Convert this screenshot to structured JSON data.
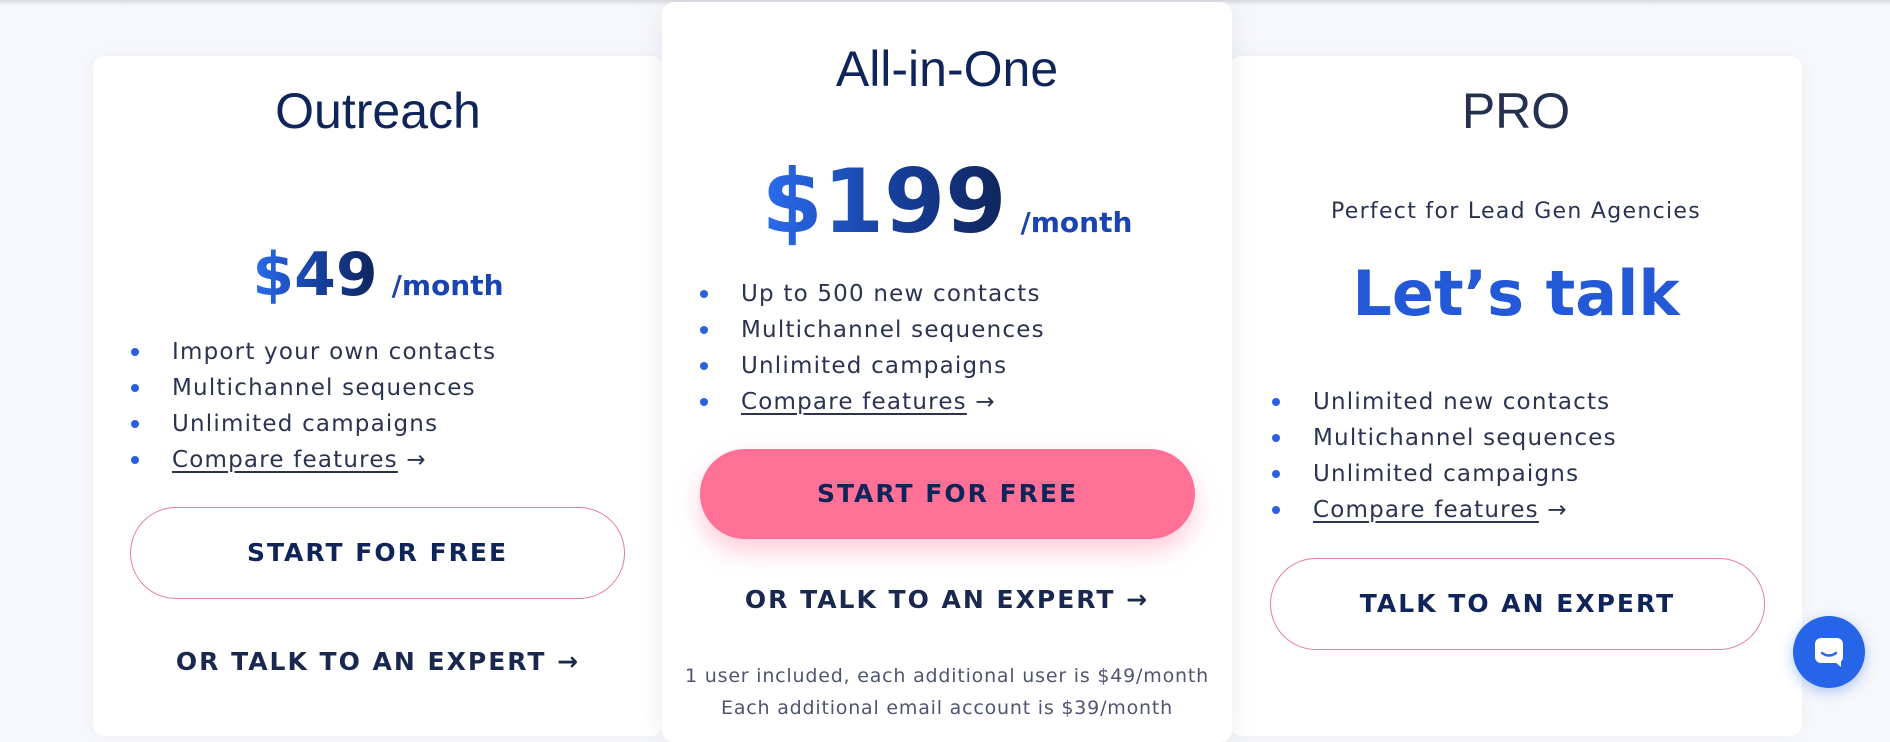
{
  "plans": {
    "outreach": {
      "name": "Outreach",
      "price": "$49",
      "per": "/month",
      "features": [
        "Import your own contacts",
        "Multichannel sequences",
        "Unlimited campaigns"
      ],
      "compare": "Compare features",
      "compare_arrow": " →",
      "cta": "START FOR FREE",
      "secondary": "OR TALK TO AN EXPERT →"
    },
    "allinone": {
      "name": "All-in-One",
      "price": "$199",
      "per": "/month",
      "features": [
        "Up to 500 new contacts",
        "Multichannel sequences",
        "Unlimited campaigns"
      ],
      "compare": "Compare features",
      "compare_arrow": " →",
      "cta": "START FOR FREE",
      "secondary": "OR TALK TO AN EXPERT →",
      "note1": "1 user included, each additional user is $49/month",
      "note2": "Each additional email account is $39/month"
    },
    "pro": {
      "name": "PRO",
      "tagline": "Perfect for Lead Gen Agencies",
      "price_text": "Let’s talk",
      "features": [
        "Unlimited new contacts",
        "Multichannel sequences",
        "Unlimited campaigns"
      ],
      "compare": "Compare features",
      "compare_arrow": " →",
      "cta": "TALK TO AN EXPERT"
    }
  },
  "colors": {
    "brand_navy": "#0f2459",
    "accent_blue": "#2b6cf0",
    "cta_pink": "#ff7097",
    "chat_blue": "#2664e8"
  },
  "icons": {
    "chat_widget": "chat-bubble-icon"
  }
}
